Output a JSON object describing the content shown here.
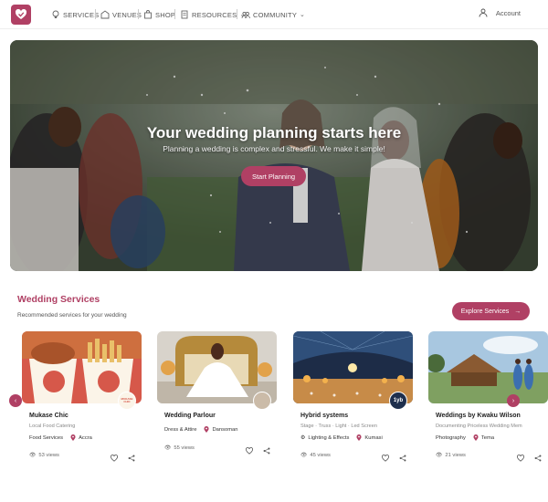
{
  "nav": {
    "items": [
      {
        "label": "SERVICES",
        "icon": "lightbulb-icon"
      },
      {
        "label": "VENUES",
        "icon": "venue-icon"
      },
      {
        "label": "SHOP",
        "icon": "shop-icon"
      },
      {
        "label": "RESOURCES",
        "icon": "document-icon"
      },
      {
        "label": "COMMUNITY",
        "icon": "community-icon"
      }
    ],
    "account_label": "Account"
  },
  "hero": {
    "title": "Your wedding planning starts here",
    "subtitle": "Planning a wedding is complex and stressful. We make it simple!",
    "button_label": "Start Planning"
  },
  "section": {
    "title": "Wedding Services",
    "subtitle": "Recommended services for your wedding",
    "explore_label": "Explore Services"
  },
  "cards": [
    {
      "name": "Mukase Chic",
      "description": "Local Food Catering",
      "category": "Food Services",
      "location": "Accra",
      "views": "53 views",
      "badge_text": "MUKASE CHIC"
    },
    {
      "name": "Wedding Parlour",
      "description": "",
      "category": "Dress & Attire",
      "location": "Dansoman",
      "views": "55 views",
      "badge_text": ""
    },
    {
      "name": "Hybrid systems",
      "description": "Stage · Truss · Light · Led Screen",
      "category": "Lighting & Effects",
      "location": "Kumasi",
      "views": "45 views",
      "badge_text": "1yb"
    },
    {
      "name": "Weddings by Kwaku Wilson",
      "description": "Documenting Priceless Wedding Mem",
      "category": "Photography",
      "location": "Tema",
      "views": "21 views",
      "badge_text": ""
    }
  ],
  "colors": {
    "brand": "#b04064"
  }
}
